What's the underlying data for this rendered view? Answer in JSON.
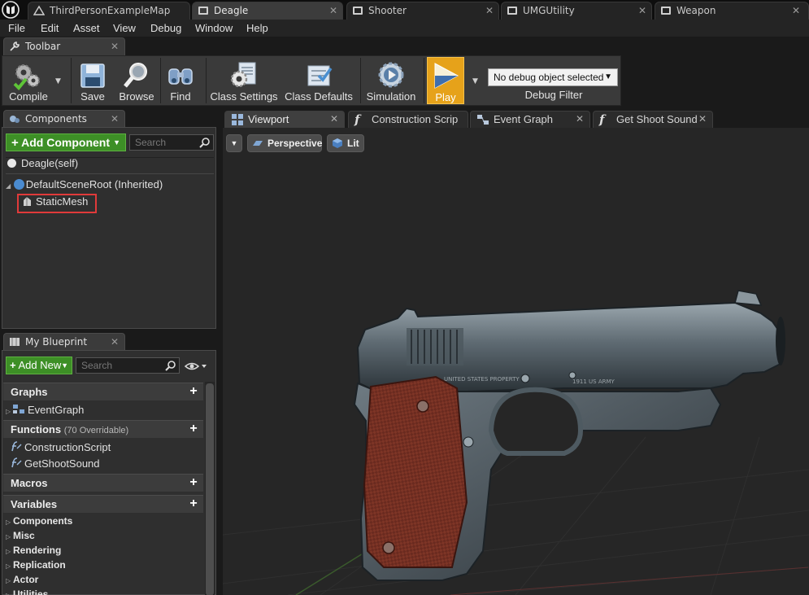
{
  "document_tabs": [
    {
      "label": "ThirdPersonExampleMap"
    },
    {
      "label": "Deagle"
    },
    {
      "label": "Shooter"
    },
    {
      "label": "UMGUtility"
    },
    {
      "label": "Weapon"
    }
  ],
  "menu": [
    "File",
    "Edit",
    "Asset",
    "View",
    "Debug",
    "Window",
    "Help"
  ],
  "toolbar_panel": {
    "title": "Toolbar"
  },
  "toolbar": {
    "compile": "Compile",
    "save": "Save",
    "browse": "Browse",
    "find": "Find",
    "class_settings": "Class Settings",
    "class_defaults": "Class Defaults",
    "simulation": "Simulation",
    "play": "Play",
    "debug_object": "No debug object selected",
    "debug_filter": "Debug Filter"
  },
  "components_panel": {
    "title": "Components",
    "add_button": "Add Component",
    "search_placeholder": "Search",
    "self_item": "Deagle(self)",
    "root_item": "DefaultSceneRoot (Inherited)",
    "child_item": "StaticMesh"
  },
  "my_blueprint": {
    "title": "My Blueprint",
    "add_button": "Add New",
    "search_placeholder": "Search",
    "graphs_header": "Graphs",
    "graphs": [
      "EventGraph"
    ],
    "functions_header": "Functions",
    "functions_note": "(70 Overridable)",
    "functions": [
      "ConstructionScript",
      "GetShootSound"
    ],
    "macros_header": "Macros",
    "variables_header": "Variables",
    "variable_categories": [
      "Components",
      "Misc",
      "Rendering",
      "Replication",
      "Actor",
      "Utilities"
    ]
  },
  "editor_tabs": [
    {
      "label": "Viewport"
    },
    {
      "label": "Construction Scrip"
    },
    {
      "label": "Event Graph"
    },
    {
      "label": "Get Shoot Sound"
    }
  ],
  "viewport": {
    "perspective": "Perspective",
    "lit": "Lit",
    "gun_markings": {
      "left": "UNITED STATES PROPERTY",
      "right": "1911 US ARMY"
    }
  },
  "colors": {
    "accent_play": "#e6a21a",
    "add_button_green": "#3d8f26",
    "selection_highlight": "#e03a3a"
  }
}
